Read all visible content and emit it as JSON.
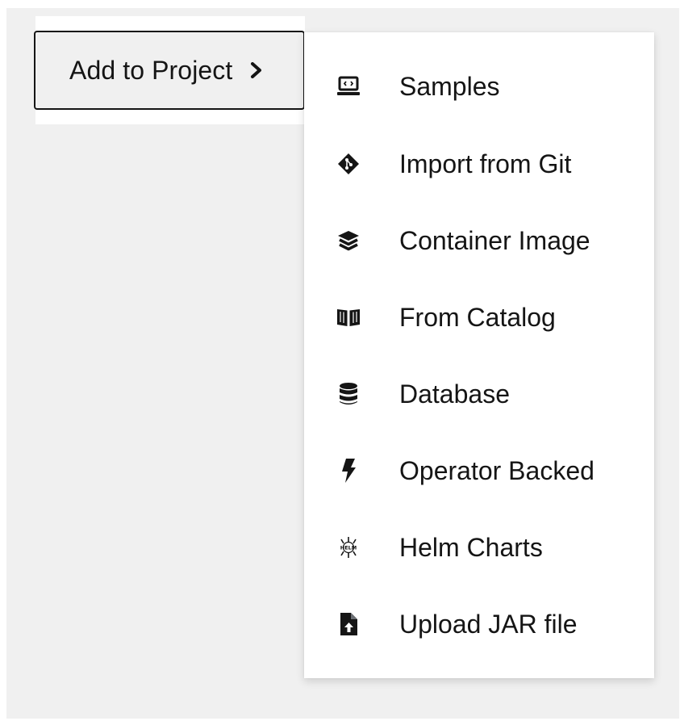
{
  "trigger": {
    "label": "Add to Project",
    "icon": "chevron-right-icon"
  },
  "menu": {
    "items": [
      {
        "label": "Samples",
        "icon": "laptop-code-icon"
      },
      {
        "label": "Import from Git",
        "icon": "git-icon"
      },
      {
        "label": "Container Image",
        "icon": "layers-icon"
      },
      {
        "label": "From Catalog",
        "icon": "book-open-icon"
      },
      {
        "label": "Database",
        "icon": "database-icon"
      },
      {
        "label": "Operator Backed",
        "icon": "bolt-icon"
      },
      {
        "label": "Helm Charts",
        "icon": "helm-icon"
      },
      {
        "label": "Upload JAR file",
        "icon": "file-upload-icon"
      }
    ]
  },
  "colors": {
    "text": "#151515",
    "canvas": "#f0f0f0",
    "menu_background": "#ffffff"
  }
}
